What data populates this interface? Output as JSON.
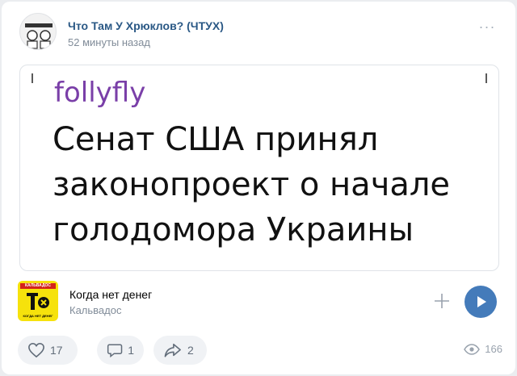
{
  "post": {
    "group_name": "Что Там У Хрюклов? (ЧТУХ)",
    "time": "52 минуты назад",
    "more_icon": "more-horizontal-icon"
  },
  "meme": {
    "author": "follyfly",
    "text_lines": [
      "Сенат США принял",
      "законопроект о начале",
      "голодомора Украины"
    ]
  },
  "audio": {
    "title": "Когда нет денег",
    "artist": "Кальвадос",
    "cover_top_label": "КАЛЬВАДОС",
    "cover_bottom_label": "КОГДА НЕТ ДЕНЕГ",
    "accent_color": "#447bba"
  },
  "actions": {
    "likes": "17",
    "comments": "1",
    "shares": "2",
    "views": "166"
  }
}
